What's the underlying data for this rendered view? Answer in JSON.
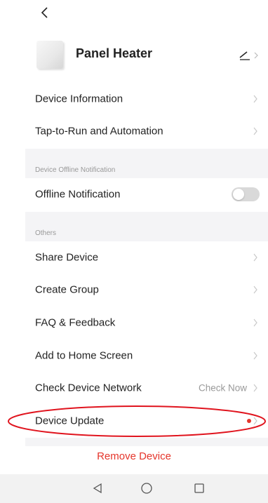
{
  "header": {
    "device_name": "Panel Heater"
  },
  "icons": {
    "back": "chevron-left-icon",
    "edit": "pencil-icon",
    "chevron": "chevron-right-icon",
    "nav_back": "triangle-back-icon",
    "nav_home": "circle-home-icon",
    "nav_recent": "square-recent-icon"
  },
  "rows": {
    "device_information": "Device Information",
    "tap_to_run": "Tap-to-Run and Automation",
    "offline_notification": "Offline Notification",
    "share_device": "Share Device",
    "create_group": "Create Group",
    "faq": "FAQ & Feedback",
    "add_home_screen": "Add to Home Screen",
    "check_network": "Check Device Network",
    "check_now": "Check Now",
    "device_update": "Device Update"
  },
  "sections": {
    "offline_title": "Device Offline Notification",
    "others_title": "Others"
  },
  "offline_toggle_on": false,
  "remove_label": "Remove Device",
  "colors": {
    "accent_red": "#e5352b",
    "muted_text": "#999999",
    "section_bg": "#f4f4f6",
    "toggle_off": "#d9d9d9"
  }
}
